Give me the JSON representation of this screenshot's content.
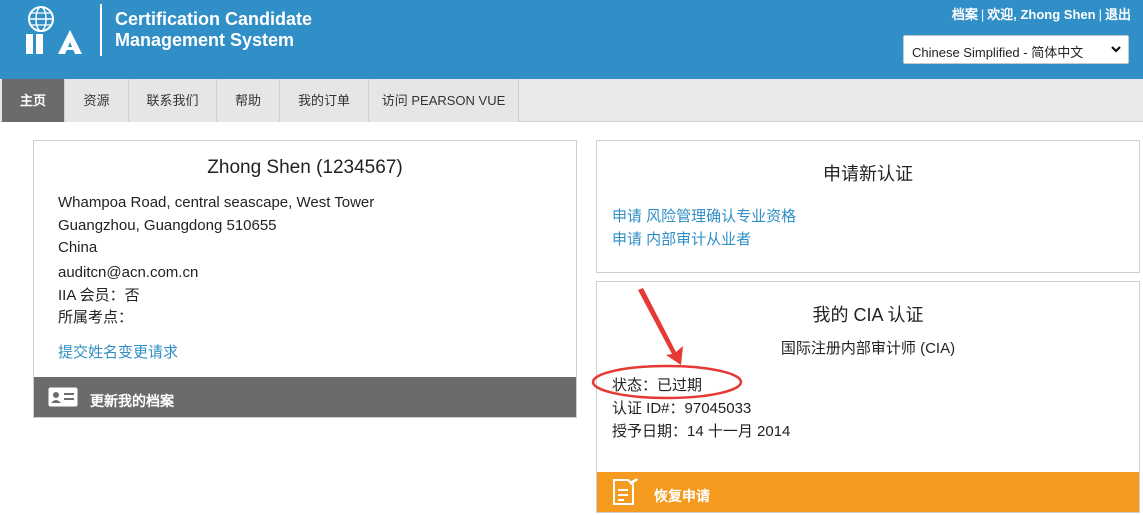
{
  "header": {
    "title_line1": "Certification Candidate",
    "title_line2": "Management System",
    "links": {
      "profile": "档案",
      "welcome": "欢迎, Zhong Shen",
      "logout": "退出"
    },
    "language": "Chinese Simplified - 简体中文",
    "colors": {
      "header": "#2f8fc6",
      "white": "#ffffff"
    }
  },
  "nav": {
    "items": [
      "主页",
      "资源",
      "联系我们",
      "帮助",
      "我的订单",
      "访问 PEARSON VUE"
    ],
    "active_index": 0
  },
  "profile": {
    "name": "Zhong Shen (1234567)",
    "address_line1": "Whampoa Road, central seascape, West Tower",
    "address_line2": "Guangzhou, Guangdong 510655",
    "address_line3": "China",
    "email": "auditcn@acn.com.cn",
    "member": "IIA 会员：否",
    "test_site": "所属考点：",
    "name_change_link": "提交姓名变更请求",
    "update_button": "更新我的档案"
  },
  "new_cert": {
    "title": "申请新认证",
    "links": [
      "申请 风险管理确认专业资格",
      "申请 内部审计从业者"
    ]
  },
  "my_cert": {
    "title": "我的 CIA 认证",
    "cert_name": "国际注册内部审计师 (CIA)",
    "status": "状态：已过期",
    "cert_id": "认证 ID#：97045033",
    "grant_date": "授予日期：14 十一月 2014",
    "renew_button": "恢复申请",
    "colors": {
      "renew": "#f39a1f",
      "link": "#2f8fc6",
      "annotation": "#e53935"
    }
  }
}
